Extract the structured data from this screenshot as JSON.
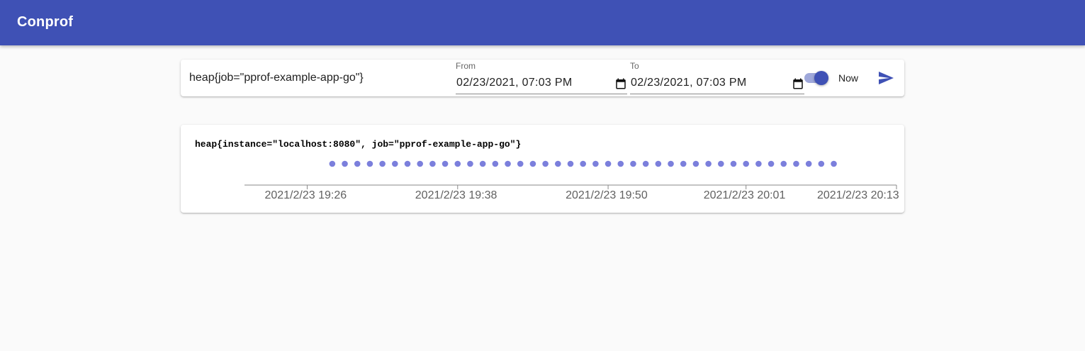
{
  "app": {
    "title": "Conprof"
  },
  "query": {
    "expression": "heap{job=\"pprof-example-app-go\"}",
    "from_label": "From",
    "from_value": "02/23/2021, 07:03 PM",
    "to_label": "To",
    "to_value": "02/23/2021, 07:03 PM",
    "now_toggle": {
      "label": "Now",
      "checked": true
    },
    "execute_icon": "send-icon",
    "calendar_icon": "calendar-icon"
  },
  "colors": {
    "primary": "#3f51b5",
    "point": "#7b7fdc",
    "toggle_track": "#9fa8da"
  },
  "series": [
    {
      "label": "heap{instance=\"localhost:8080\", job=\"pprof-example-app-go\"}"
    }
  ],
  "chart_data": {
    "type": "scatter",
    "x_axis": {
      "type": "time",
      "range": [
        "2021-02-23 19:21",
        "2021-02-23 20:13"
      ],
      "ticks": [
        {
          "value": "2021-02-23 19:26",
          "label": "2021/2/23 19:26"
        },
        {
          "value": "2021-02-23 19:38",
          "label": "2021/2/23 19:38"
        },
        {
          "value": "2021-02-23 19:50",
          "label": "2021/2/23 19:50"
        },
        {
          "value": "2021-02-23 20:01",
          "label": "2021/2/23 20:01"
        },
        {
          "value": "2021-02-23 20:13",
          "label": "2021/2/23 20:13"
        }
      ]
    },
    "series": [
      {
        "name": "heap{instance=\"localhost:8080\", job=\"pprof-example-app-go\"}",
        "x": [
          "2021-02-23 19:28",
          "2021-02-23 19:29",
          "2021-02-23 19:30",
          "2021-02-23 19:31",
          "2021-02-23 19:32",
          "2021-02-23 19:33",
          "2021-02-23 19:34",
          "2021-02-23 19:35",
          "2021-02-23 19:36",
          "2021-02-23 19:37",
          "2021-02-23 19:38",
          "2021-02-23 19:39",
          "2021-02-23 19:40",
          "2021-02-23 19:41",
          "2021-02-23 19:42",
          "2021-02-23 19:43",
          "2021-02-23 19:44",
          "2021-02-23 19:45",
          "2021-02-23 19:46",
          "2021-02-23 19:47",
          "2021-02-23 19:48",
          "2021-02-23 19:49",
          "2021-02-23 19:50",
          "2021-02-23 19:51",
          "2021-02-23 19:52",
          "2021-02-23 19:53",
          "2021-02-23 19:54",
          "2021-02-23 19:55",
          "2021-02-23 19:56",
          "2021-02-23 19:57",
          "2021-02-23 19:58",
          "2021-02-23 19:59",
          "2021-02-23 20:00",
          "2021-02-23 20:01",
          "2021-02-23 20:02",
          "2021-02-23 20:03",
          "2021-02-23 20:04",
          "2021-02-23 20:05",
          "2021-02-23 20:06",
          "2021-02-23 20:07",
          "2021-02-23 20:08"
        ]
      }
    ]
  }
}
